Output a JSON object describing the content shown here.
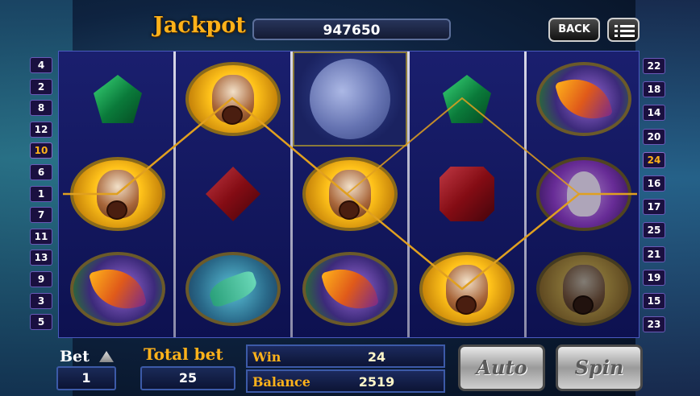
{
  "jackpot": {
    "label": "Jackpot",
    "value": "947650"
  },
  "header_buttons": {
    "back": "BACK",
    "menu": "menu"
  },
  "lines_left": [
    "4",
    "2",
    "8",
    "12",
    "10",
    "6",
    "1",
    "7",
    "11",
    "13",
    "9",
    "3",
    "5"
  ],
  "lines_right": [
    "22",
    "18",
    "14",
    "20",
    "24",
    "16",
    "17",
    "25",
    "21",
    "19",
    "15",
    "23"
  ],
  "active_lines": {
    "left": "10",
    "right": "24"
  },
  "reels": [
    [
      "emerald",
      "squirrel",
      "butterfly"
    ],
    [
      "squirrel",
      "ruby",
      "hummingbird"
    ],
    [
      "moon",
      "squirrel",
      "butterfly"
    ],
    [
      "emerald",
      "ruby",
      "squirrel"
    ],
    [
      "butterfly",
      "rabbit",
      "squirrel"
    ]
  ],
  "bottom": {
    "bet_label": "Bet",
    "bet_value": "1",
    "total_bet_label": "Total bet",
    "total_bet_value": "25",
    "win_label": "Win",
    "win_value": "24",
    "balance_label": "Balance",
    "balance_value": "2519",
    "auto_label": "Auto",
    "spin_label": "Spin"
  },
  "colors": {
    "payline": "#e0a020",
    "accent": "#ffb21a"
  }
}
